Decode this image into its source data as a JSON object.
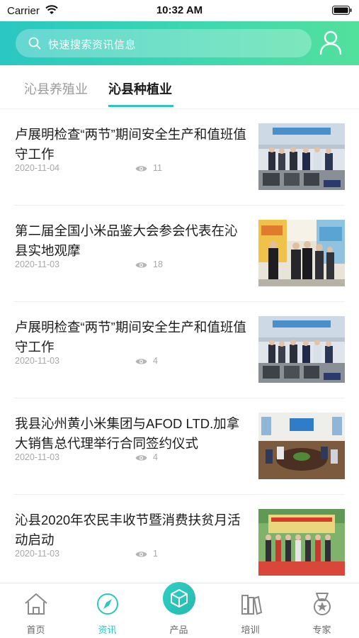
{
  "status_bar": {
    "carrier": "Carrier",
    "time": "10:32 AM"
  },
  "header": {
    "search_placeholder": "快速搜索资讯信息",
    "search_icon": "search-icon",
    "user_icon": "user-icon"
  },
  "tabs": [
    {
      "label": "沁县养殖业",
      "active": false
    },
    {
      "label": "沁县种植业",
      "active": true
    }
  ],
  "accent_color": "#2ac7c2",
  "news": [
    {
      "title": "卢展明检查“两节”期间安全生产和值班值守工作",
      "date": "2020-11-04",
      "views": "11",
      "image": "meeting-photo"
    },
    {
      "title": "第二届全国小米品鉴大会参会代表在沁县实地观摩",
      "date": "2020-11-03",
      "views": "18",
      "image": "visit-photo"
    },
    {
      "title": "卢展明检查“两节”期间安全生产和值班值守工作",
      "date": "2020-11-03",
      "views": "4",
      "image": "meeting-photo"
    },
    {
      "title": "我县沁州黄小米集团与AFOD LTD.加拿大销售总代理举行合同签约仪式",
      "date": "2020-11-03",
      "views": "4",
      "image": "signing-photo"
    },
    {
      "title": "沁县2020年农民丰收节暨消费扶贫月活动启动",
      "date": "2020-11-03",
      "views": "1",
      "image": "festival-photo"
    }
  ],
  "tabbar": [
    {
      "label": "首页",
      "icon": "home-icon",
      "active": false
    },
    {
      "label": "资讯",
      "icon": "compass-icon",
      "active": true
    },
    {
      "label": "产品",
      "icon": "box-icon",
      "active": false
    },
    {
      "label": "培训",
      "icon": "books-icon",
      "active": false
    },
    {
      "label": "专家",
      "icon": "medal-icon",
      "active": false
    }
  ]
}
